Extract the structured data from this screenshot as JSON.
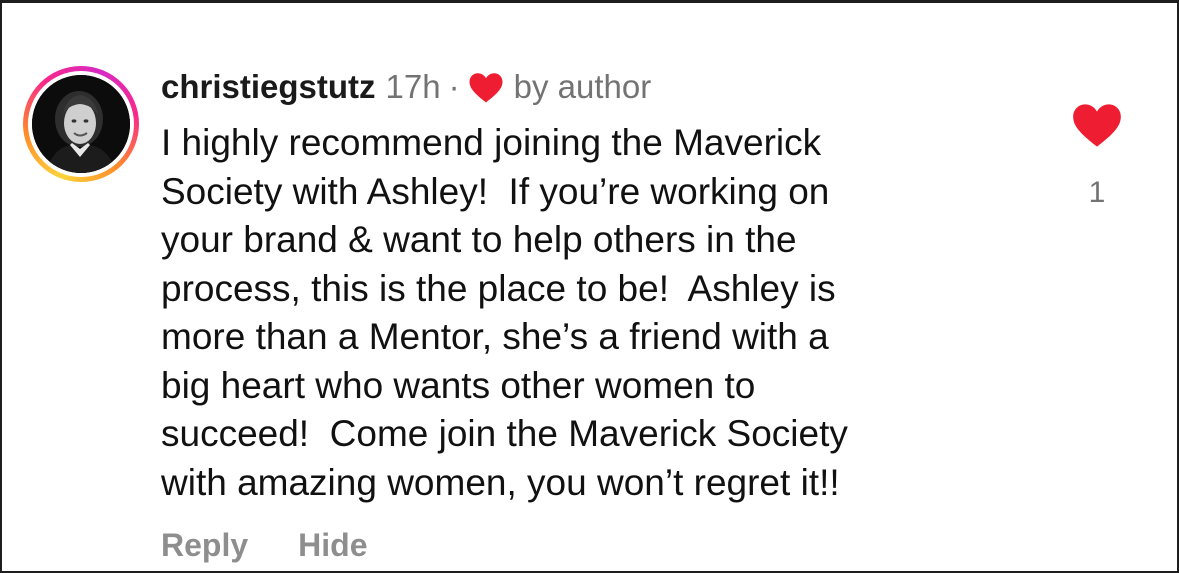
{
  "comment": {
    "username": "christiegstutz",
    "timestamp": "17h",
    "separator": "·",
    "liked_by_label": "by author",
    "body": "I highly recommend joining the Maverick\nSociety with Ashley!  If you’re working on\nyour brand & want to help others in the\nprocess, this is the place to be!  Ashley is\nmore than a Mentor, she’s a friend with a\nbig heart who wants other women to\nsucceed!  Come join the Maverick Society\nwith amazing women, you won’t regret it!!",
    "like_count": "1",
    "liked": true
  },
  "actions": {
    "reply_label": "Reply",
    "hide_label": "Hide"
  },
  "icons": {
    "avatar": "profile-photo",
    "author_heart": "heart-icon",
    "like": "heart-filled-icon"
  },
  "colors": {
    "heart": "#ef1d31",
    "muted_text": "#737373",
    "action_text": "#8e8e8e",
    "story_ring": [
      "#ffd43b",
      "#ff8c2a",
      "#f7288a",
      "#d62ac4"
    ]
  }
}
